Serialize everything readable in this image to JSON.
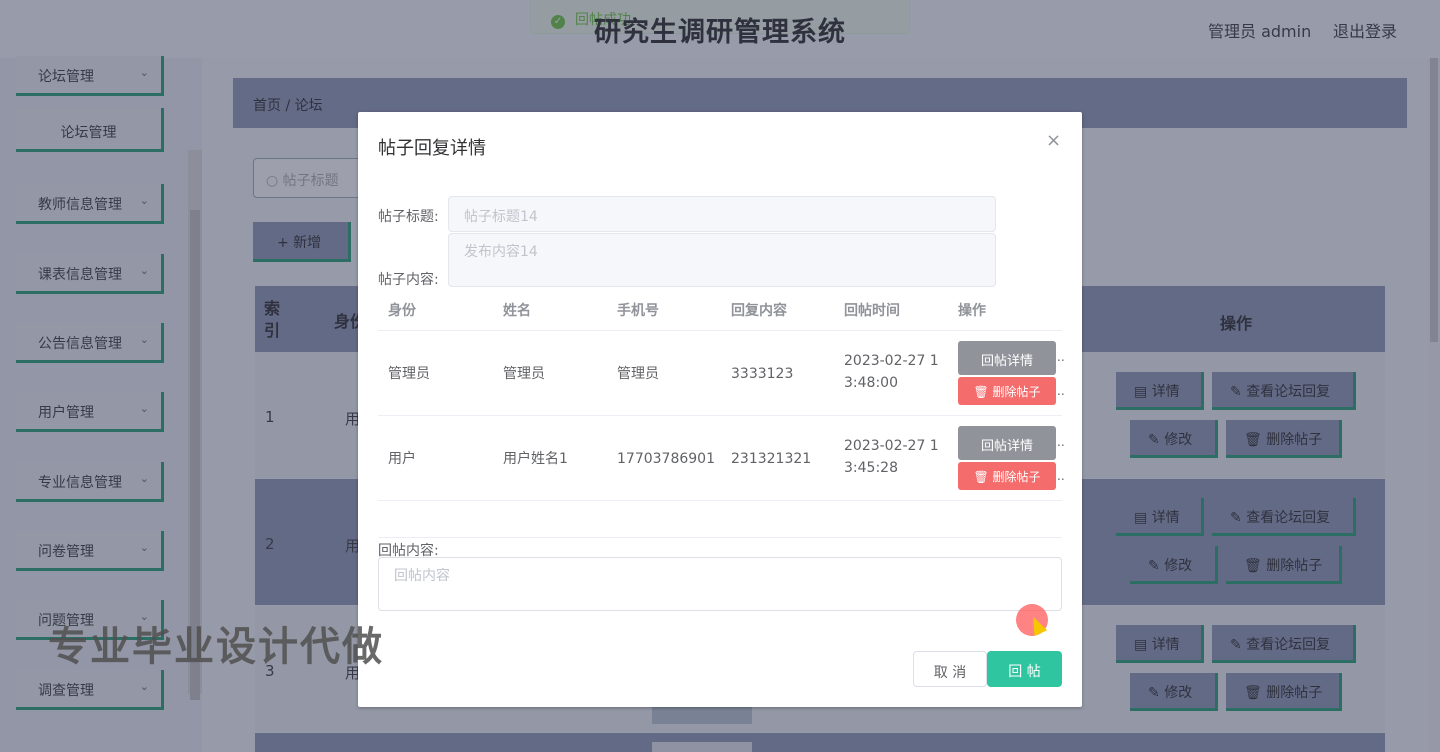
{
  "header": {
    "title": "研究生调研管理系统",
    "admin": "管理员 admin",
    "logout": "退出登录",
    "toast": "回帖成功"
  },
  "sidebar": {
    "items": [
      {
        "label": "论坛管理",
        "chev": "⌄"
      },
      {
        "label": "论坛管理",
        "chev": ""
      },
      {
        "label": "教师信息管理",
        "chev": "⌄"
      },
      {
        "label": "课表信息管理",
        "chev": "⌄"
      },
      {
        "label": "公告信息管理",
        "chev": "⌄"
      },
      {
        "label": "用户管理",
        "chev": "⌄"
      },
      {
        "label": "专业信息管理",
        "chev": "⌄"
      },
      {
        "label": "问卷管理",
        "chev": "⌄"
      },
      {
        "label": "问题管理",
        "chev": "⌄"
      },
      {
        "label": "调查管理",
        "chev": "⌄"
      }
    ]
  },
  "breadcrumb": {
    "home": "首页",
    "sep": "/",
    "current": "论坛"
  },
  "search": {
    "placeholder": "帖子标题"
  },
  "toolbar": {
    "add": "+ 新增"
  },
  "table": {
    "idx_header": "索引",
    "identity_header": "身份",
    "op_header": "操作",
    "rows": [
      {
        "idx": "1",
        "ident": "用"
      },
      {
        "idx": "2",
        "ident": "用"
      },
      {
        "idx": "3",
        "ident": "用"
      }
    ],
    "ops": {
      "detail": "详情",
      "view_reply": "查看论坛回复",
      "edit": "修改",
      "delete": "删除帖子"
    }
  },
  "dialog": {
    "title": "帖子回复详情",
    "close": "×",
    "post_title_label": "帖子标题:",
    "post_title_value": "帖子标题14",
    "post_content_label": "帖子内容:",
    "post_content_value": "发布内容14",
    "columns": [
      "身份",
      "姓名",
      "手机号",
      "回复内容",
      "回帖时间",
      "操作"
    ],
    "rows": [
      {
        "identity": "管理员",
        "name": "管理员",
        "phone": "管理员",
        "content": "3333123",
        "time": "2023-02-27 13:48:00"
      },
      {
        "identity": "用户",
        "name": "用户姓名1",
        "phone": "17703786901",
        "content": "231321321",
        "time": "2023-02-27 13:45:28"
      }
    ],
    "reply_detail": "回帖详情",
    "delete_reply": "删除帖子",
    "ellipsis": "..",
    "reply_label": "回帖内容:",
    "reply_placeholder": "回帖内容",
    "cancel": "取 消",
    "submit": "回 帖"
  },
  "watermark": "专业毕业设计代做",
  "colors": {
    "accent": "#2fc5a0",
    "danger": "#f56c6c",
    "info": "#909399",
    "border_green": "#1c9a6c",
    "header_bg": "#8a93b2"
  }
}
